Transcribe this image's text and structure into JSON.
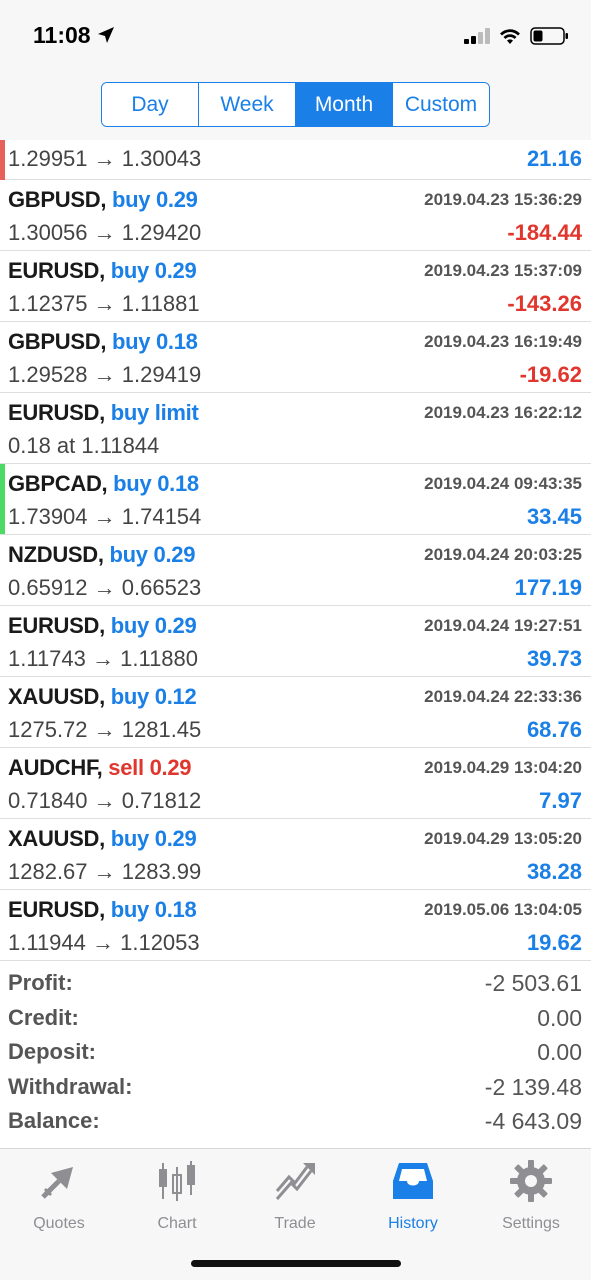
{
  "status_bar": {
    "time": "11:08"
  },
  "period_tabs": [
    {
      "label": "Day",
      "active": false
    },
    {
      "label": "Week",
      "active": false
    },
    {
      "label": "Month",
      "active": true
    },
    {
      "label": "Custom",
      "active": false
    }
  ],
  "partial_row": {
    "prices": "1.29951 → 1.30043",
    "profit": "21.16",
    "profit_sign": "pos",
    "marker_color": "#e8605a"
  },
  "trades": [
    {
      "symbol": "GBPUSD,",
      "action": "buy 0.29",
      "side": "buy",
      "time": "2019.04.23 15:36:29",
      "prices": "1.30056 → 1.29420",
      "profit": "-184.44",
      "profit_sign": "neg"
    },
    {
      "symbol": "EURUSD,",
      "action": "buy 0.29",
      "side": "buy",
      "time": "2019.04.23 15:37:09",
      "prices": "1.12375 → 1.11881",
      "profit": "-143.26",
      "profit_sign": "neg"
    },
    {
      "symbol": "GBPUSD,",
      "action": "buy 0.18",
      "side": "buy",
      "time": "2019.04.23 16:19:49",
      "prices": "1.29528 → 1.29419",
      "profit": "-19.62",
      "profit_sign": "neg"
    },
    {
      "symbol": "EURUSD,",
      "action": "buy limit",
      "side": "buy",
      "time": "2019.04.23 16:22:12",
      "prices": "0.18 at 1.11844",
      "profit": "",
      "profit_sign": "pos"
    },
    {
      "symbol": "GBPCAD,",
      "action": "buy 0.18",
      "side": "buy",
      "time": "2019.04.24 09:43:35",
      "prices": "1.73904 → 1.74154",
      "profit": "33.45",
      "profit_sign": "pos",
      "marker": true
    },
    {
      "symbol": "NZDUSD,",
      "action": "buy 0.29",
      "side": "buy",
      "time": "2019.04.24 20:03:25",
      "prices": "0.65912 → 0.66523",
      "profit": "177.19",
      "profit_sign": "pos"
    },
    {
      "symbol": "EURUSD,",
      "action": "buy 0.29",
      "side": "buy",
      "time": "2019.04.24 19:27:51",
      "prices": "1.11743 → 1.11880",
      "profit": "39.73",
      "profit_sign": "pos"
    },
    {
      "symbol": "XAUUSD,",
      "action": "buy 0.12",
      "side": "buy",
      "time": "2019.04.24 22:33:36",
      "prices": "1275.72 → 1281.45",
      "profit": "68.76",
      "profit_sign": "pos"
    },
    {
      "symbol": "AUDCHF,",
      "action": "sell 0.29",
      "side": "sell",
      "time": "2019.04.29 13:04:20",
      "prices": "0.71840 → 0.71812",
      "profit": "7.97",
      "profit_sign": "pos"
    },
    {
      "symbol": "XAUUSD,",
      "action": "buy 0.29",
      "side": "buy",
      "time": "2019.04.29 13:05:20",
      "prices": "1282.67 → 1283.99",
      "profit": "38.28",
      "profit_sign": "pos"
    },
    {
      "symbol": "EURUSD,",
      "action": "buy 0.18",
      "side": "buy",
      "time": "2019.05.06 13:04:05",
      "prices": "1.11944 → 1.12053",
      "profit": "19.62",
      "profit_sign": "pos"
    }
  ],
  "summary": [
    {
      "label": "Profit:",
      "value": "-2 503.61"
    },
    {
      "label": "Credit:",
      "value": "0.00"
    },
    {
      "label": "Deposit:",
      "value": "0.00"
    },
    {
      "label": "Withdrawal:",
      "value": "-2 139.48"
    },
    {
      "label": "Balance:",
      "value": "-4 643.09"
    }
  ],
  "tab_bar": [
    {
      "label": "Quotes",
      "icon": "quotes-icon",
      "active": false
    },
    {
      "label": "Chart",
      "icon": "chart-icon",
      "active": false
    },
    {
      "label": "Trade",
      "icon": "trade-icon",
      "active": false
    },
    {
      "label": "History",
      "icon": "history-icon",
      "active": true
    },
    {
      "label": "Settings",
      "icon": "settings-icon",
      "active": false
    }
  ],
  "colors": {
    "accent": "#1a7fe6",
    "negative": "#e0362d",
    "positive_marker": "#4cd964",
    "loss_marker": "#e8605a"
  }
}
